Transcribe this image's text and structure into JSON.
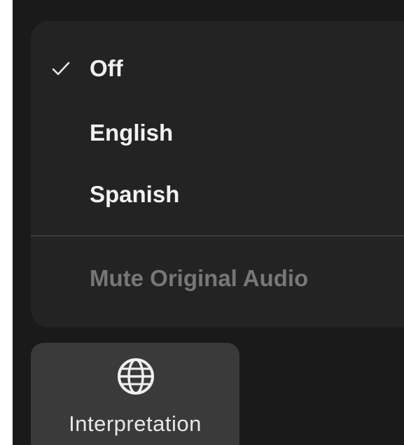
{
  "menu": {
    "items": [
      {
        "label": "Off",
        "checked": true
      },
      {
        "label": "English",
        "checked": false
      },
      {
        "label": "Spanish",
        "checked": false
      }
    ],
    "mute_label": "Mute Original Audio"
  },
  "toolbar": {
    "interpretation_label": "Interpretation",
    "interpretation_icon": "globe-icon"
  },
  "colors": {
    "app_background": "#1a1a1a",
    "menu_background": "#232323",
    "button_background": "#3a3a3a",
    "text_primary": "#f2f2f2",
    "text_disabled": "#777777"
  }
}
